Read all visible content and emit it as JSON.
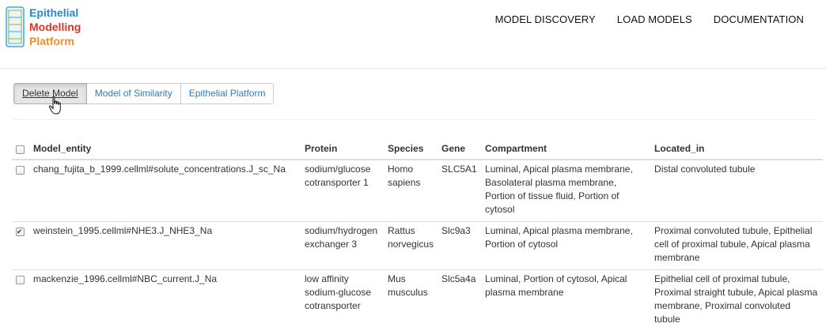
{
  "logo": {
    "line1": "Epithelial",
    "line2": "Modelling",
    "line3": "Platform"
  },
  "nav": {
    "items": [
      "MODEL DISCOVERY",
      "LOAD MODELS",
      "DOCUMENTATION"
    ]
  },
  "toolbar": {
    "delete": "Delete Model",
    "similarity": "Model of Similarity",
    "platform": "Epithelial Platform"
  },
  "table": {
    "headers": [
      "Model_entity",
      "Protein",
      "Species",
      "Gene",
      "Compartment",
      "Located_in"
    ],
    "rows": [
      {
        "checked": false,
        "entity": "chang_fujita_b_1999.cellml#solute_concentrations.J_sc_Na",
        "protein": "sodium/glucose cotransporter 1",
        "species": "Homo sapiens",
        "gene": "SLC5A1",
        "compartment": "Luminal, Apical plasma membrane, Basolateral plasma membrane, Portion of tissue fluid, Portion of cytosol",
        "located_in": "Distal convoluted tubule"
      },
      {
        "checked": true,
        "entity": "weinstein_1995.cellml#NHE3.J_NHE3_Na",
        "protein": "sodium/hydrogen exchanger 3",
        "species": "Rattus norvegicus",
        "gene": "Slc9a3",
        "compartment": "Luminal, Apical plasma membrane, Portion of cytosol",
        "located_in": "Proximal convoluted tubule, Epithelial cell of proximal tubule, Apical plasma membrane"
      },
      {
        "checked": false,
        "entity": "mackenzie_1996.cellml#NBC_current.J_Na",
        "protein": "low affinity sodium-glucose cotransporter",
        "species": "Mus musculus",
        "gene": "Slc5a4a",
        "compartment": "Luminal, Portion of cytosol, Apical plasma membrane",
        "located_in": "Epithelial cell of proximal tubule, Proximal straight tubule, Apical plasma membrane, Proximal convoluted tubule"
      }
    ]
  }
}
